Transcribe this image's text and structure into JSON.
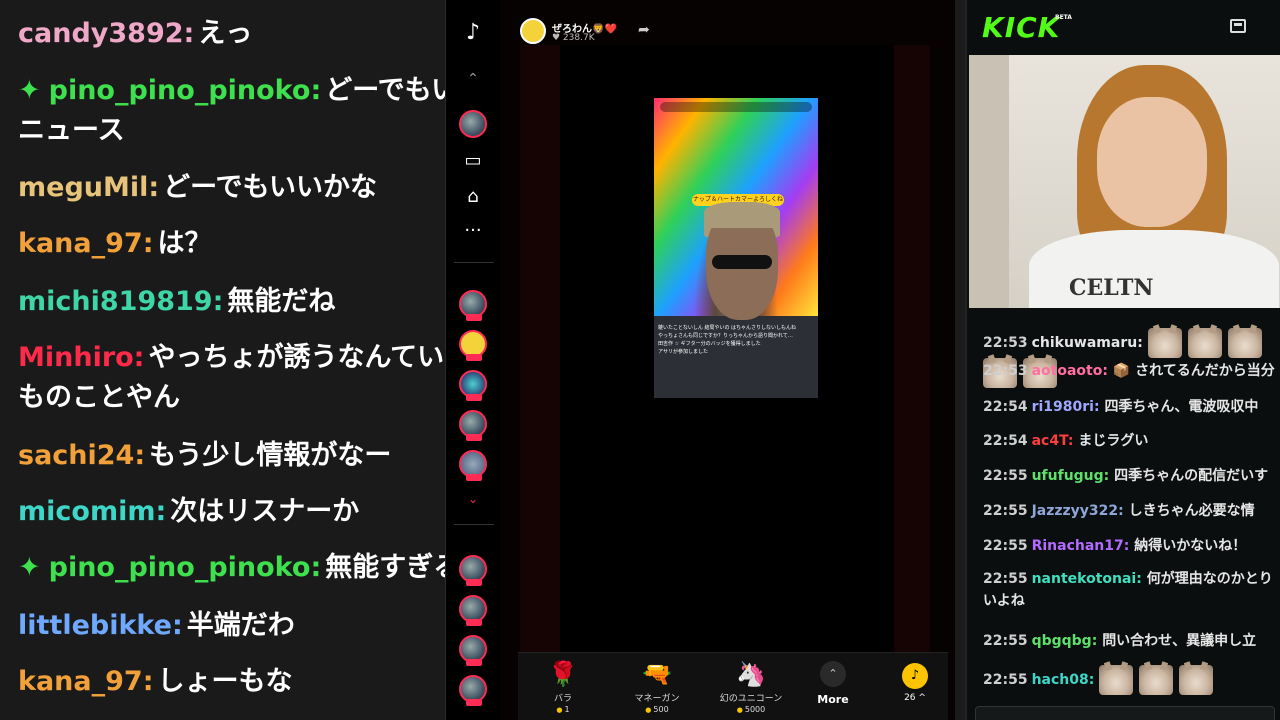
{
  "colors": {
    "tiktok_accent": "#fe2c55",
    "kick_brand": "#53fc18",
    "coin": "#ffc400"
  },
  "left_chat": {
    "messages": [
      {
        "user": "candy3892:",
        "text": "えっ",
        "color": "#f0a8c8",
        "badge": ""
      },
      {
        "user": "pino_pino_pinoko:",
        "text": "どーでもいいニュース",
        "color": "#3ee04e",
        "badge": "✦"
      },
      {
        "user": "meguMil:",
        "text": "どーでもいいかな",
        "color": "#e8c47a",
        "badge": ""
      },
      {
        "user": "kana_97:",
        "text": "は？",
        "color": "#f2a13a",
        "badge": ""
      },
      {
        "user": "michi819819:",
        "text": "無能だね",
        "color": "#3ed6a6",
        "badge": ""
      },
      {
        "user": "Minhiro:",
        "text": "やっちょが誘うなんていつものことやん",
        "color": "#ff2a4a",
        "badge": ""
      },
      {
        "user": "sachi24:",
        "text": "もう少し情報がなー",
        "color": "#f2a13a",
        "badge": ""
      },
      {
        "user": "micomim:",
        "text": "次はリスナーか",
        "color": "#3ed6c6",
        "badge": ""
      },
      {
        "user": "pino_pino_pinoko:",
        "text": "無能すぎる",
        "color": "#3ee04e",
        "badge": "✦"
      },
      {
        "user": "littlebikke:",
        "text": "半端だわ",
        "color": "#6fa9ff",
        "badge": ""
      },
      {
        "user": "kana_97:",
        "text": "しょーもな",
        "color": "#f2a13a",
        "badge": ""
      }
    ]
  },
  "tiktok": {
    "host_name": "ぜろわん🦁❤️",
    "host_likes": "♥ 238.7K",
    "share_icon": "share-arrow-icon",
    "video_banner": "ナップ＆ハートカマーよろしくね",
    "video_chat": [
      "雑いたことないしん 結局やいの はちゃんさりしないしもんね",
      "やっちょさんも同じですか？りっちゃんから語り聞かれて…",
      "田吉作 ☆ ギフター分のバッジを獲得しました",
      "アサリが参加しました"
    ],
    "gifts": [
      {
        "name": "バラ",
        "price": "1",
        "icon": "🌹"
      },
      {
        "name": "マネーガン",
        "price": "500",
        "icon": "🔫"
      },
      {
        "name": "幻のユニコーン",
        "price": "5000",
        "icon": "🦄"
      }
    ],
    "more_label": "More",
    "coins_label": "26 ^"
  },
  "kick": {
    "logo": "KICK",
    "beta": "BETA",
    "cam_shirt_text": "CELTN",
    "messages": [
      {
        "time": "22:53",
        "user": "chikuwamaru:",
        "color": "#e6e6e6",
        "text": "",
        "emotes": 5
      },
      {
        "time": "22:53",
        "user": "aotoaoto:",
        "color": "#ff6fa0",
        "text": "📦 されてるんだから当分",
        "emotes": 0
      },
      {
        "time": "22:54",
        "user": "ri1980ri:",
        "color": "#9ea8ff",
        "text": "四季ちゃん、電波吸収中",
        "emotes": 0
      },
      {
        "time": "22:54",
        "user": "ac4T:",
        "color": "#ff3d3d",
        "text": "まじラグい",
        "emotes": 0
      },
      {
        "time": "22:55",
        "user": "ufufugug:",
        "color": "#5ee06a",
        "text": "四季ちゃんの配信だいす",
        "emotes": 0
      },
      {
        "time": "22:55",
        "user": "Jazzzyy322:",
        "color": "#8fa6d8",
        "text": "しきちゃん必要な情",
        "emotes": 0
      },
      {
        "time": "22:55",
        "user": "Rinachan17:",
        "color": "#b36bff",
        "text": "納得いかないね！",
        "emotes": 0
      },
      {
        "time": "22:55",
        "user": "nantekotonai:",
        "color": "#3ee0c0",
        "text": "何が理由なのかとりいよね",
        "emotes": 0
      },
      {
        "time": "22:55",
        "user": "qbgqbg:",
        "color": "#5ee06a",
        "text": "問い合わせ、異議申し立",
        "emotes": 0
      },
      {
        "time": "22:55",
        "user": "hach08:",
        "color": "#3ed6c6",
        "text": "",
        "emotes": 3
      }
    ]
  }
}
